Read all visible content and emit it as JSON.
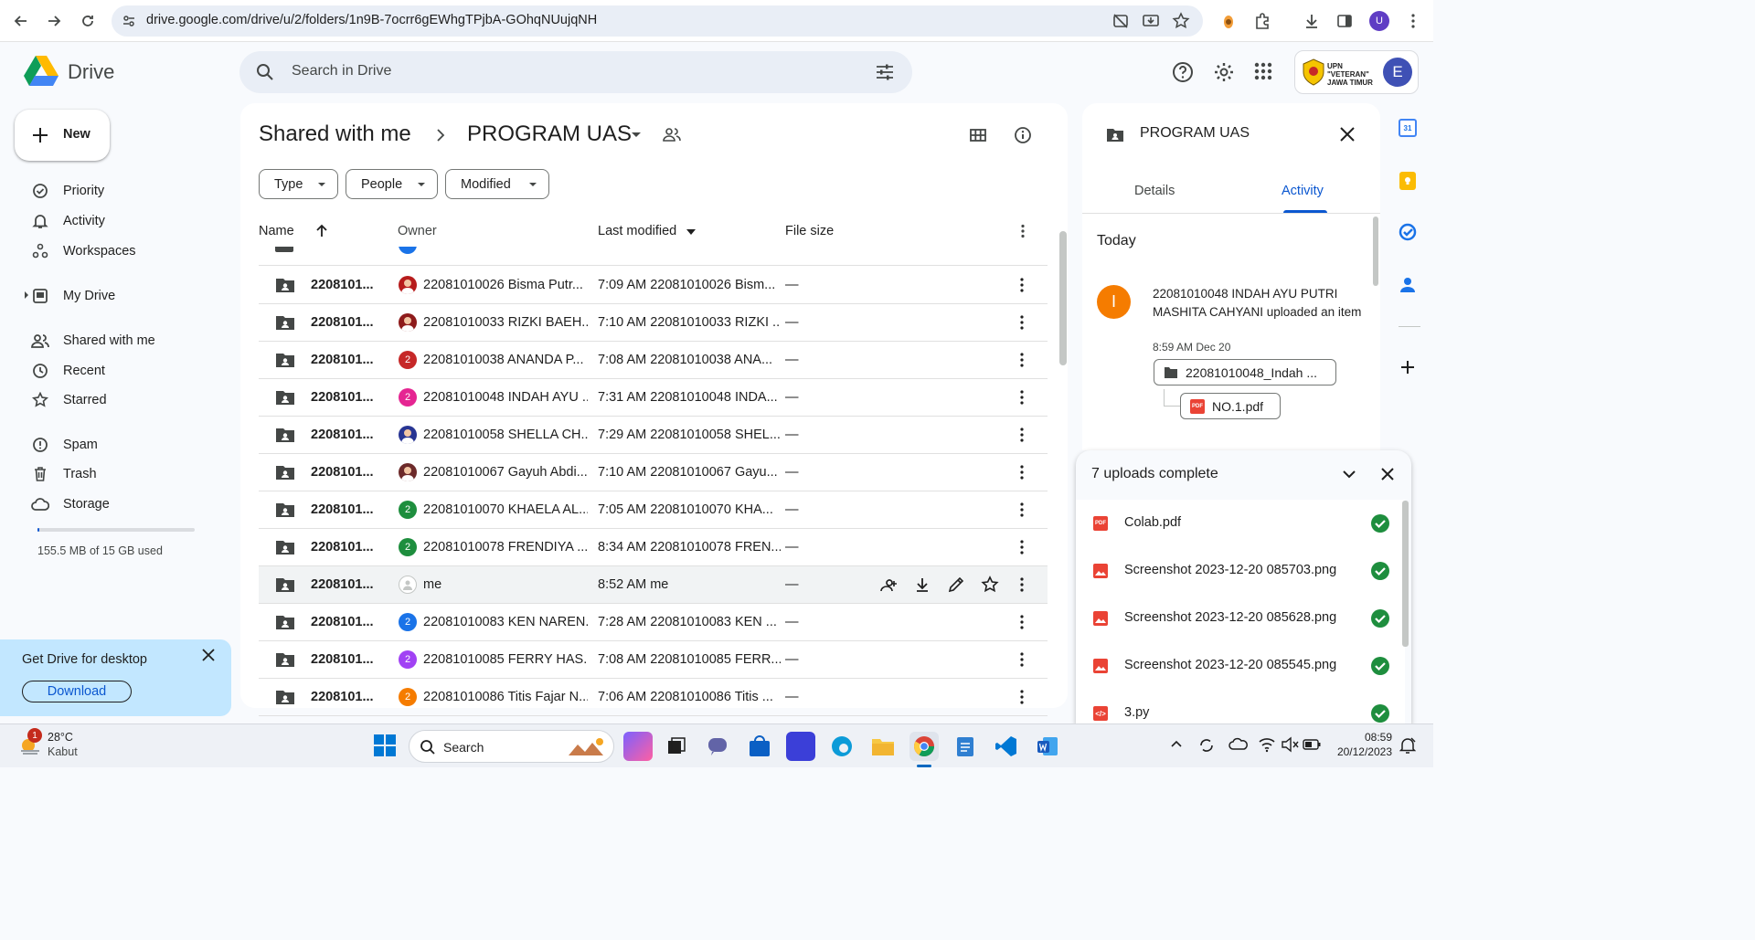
{
  "browser": {
    "url": "drive.google.com/drive/u/2/folders/1n9B-7ocrr6gEWhgTPjbA-GOhqNUujqNH",
    "profile_initial": "U"
  },
  "header": {
    "app_name": "Drive",
    "search_placeholder": "Search in Drive",
    "org_logo_text": "UPN \"VETERAN\" JAWA TIMUR",
    "account_initial": "E"
  },
  "sidebar": {
    "new_label": "New",
    "items": [
      {
        "label": "Priority",
        "icon": "checkbox-icon"
      },
      {
        "label": "Activity",
        "icon": "bell-icon"
      },
      {
        "label": "Workspaces",
        "icon": "workspaces-icon"
      },
      {
        "label": "My Drive",
        "icon": "my-drive-icon"
      },
      {
        "label": "Shared with me",
        "icon": "people-icon"
      },
      {
        "label": "Recent",
        "icon": "clock-icon"
      },
      {
        "label": "Starred",
        "icon": "star-icon"
      },
      {
        "label": "Spam",
        "icon": "spam-icon"
      },
      {
        "label": "Trash",
        "icon": "trash-icon"
      },
      {
        "label": "Storage",
        "icon": "cloud-icon"
      }
    ],
    "storage_text": "155.5 MB of 15 GB used",
    "storage_fraction": 0.01,
    "promo_title": "Get Drive for desktop",
    "promo_button": "Download"
  },
  "main": {
    "breadcrumb_parent": "Shared with me",
    "breadcrumb_current": "PROGRAM UAS",
    "filters": [
      "Type",
      "People",
      "Modified"
    ],
    "columns": {
      "name": "Name",
      "owner": "Owner",
      "modified": "Last modified",
      "size": "File size"
    },
    "rows": [
      {
        "name": "2208101...",
        "owner": "22081010026 Bisma Putr...",
        "avatar": "photo",
        "avatar_color": "#b71c1c",
        "avatar_text": "",
        "modified": "7:09 AM  22081010026 Bism...",
        "size": "—"
      },
      {
        "name": "2208101...",
        "owner": "22081010033 RIZKI BAEH...",
        "avatar": "photo",
        "avatar_color": "#8e1b1b",
        "avatar_text": "",
        "modified": "7:10 AM  22081010033 RIZKI ...",
        "size": "—"
      },
      {
        "name": "2208101...",
        "owner": "22081010038 ANANDA P...",
        "avatar": "initial",
        "avatar_color": "#c62828",
        "avatar_text": "2",
        "modified": "7:08 AM  22081010038 ANA...",
        "size": "—"
      },
      {
        "name": "2208101...",
        "owner": "22081010048 INDAH AYU ...",
        "avatar": "initial",
        "avatar_color": "#e52592",
        "avatar_text": "2",
        "modified": "7:31 AM  22081010048 INDA...",
        "size": "—"
      },
      {
        "name": "2208101...",
        "owner": "22081010058 SHELLA CH...",
        "avatar": "photo",
        "avatar_color": "#283593",
        "avatar_text": "",
        "modified": "7:29 AM  22081010058 SHEL...",
        "size": "—"
      },
      {
        "name": "2208101...",
        "owner": "22081010067 Gayuh Abdi...",
        "avatar": "photo",
        "avatar_color": "#6d2a2a",
        "avatar_text": "",
        "modified": "7:10 AM  22081010067 Gayu...",
        "size": "—"
      },
      {
        "name": "2208101...",
        "owner": "22081010070 KHAELA AL...",
        "avatar": "initial",
        "avatar_color": "#1e8e3e",
        "avatar_text": "2",
        "modified": "7:05 AM  22081010070 KHA...",
        "size": "—"
      },
      {
        "name": "2208101...",
        "owner": "22081010078 FRENDIYA ...",
        "avatar": "initial",
        "avatar_color": "#1e8e3e",
        "avatar_text": "2",
        "modified": "8:34 AM  22081010078 FREN...",
        "size": "—"
      },
      {
        "name": "2208101...",
        "owner": "me",
        "avatar": "me",
        "avatar_color": "#dadce0",
        "avatar_text": "",
        "modified": "8:52 AM  me",
        "size": "—",
        "hovered": true
      },
      {
        "name": "2208101...",
        "owner": "22081010083 KEN NAREN...",
        "avatar": "initial",
        "avatar_color": "#1a73e8",
        "avatar_text": "2",
        "modified": "7:28 AM  22081010083 KEN ...",
        "size": "—"
      },
      {
        "name": "2208101...",
        "owner": "22081010085 FERRY HAS...",
        "avatar": "initial",
        "avatar_color": "#a142f4",
        "avatar_text": "2",
        "modified": "7:08 AM  22081010085 FERR...",
        "size": "—"
      },
      {
        "name": "2208101...",
        "owner": "22081010086 Titis Fajar N...",
        "avatar": "initial",
        "avatar_color": "#f57c00",
        "avatar_text": "2",
        "modified": "7:06 AM  22081010086 Titis ...",
        "size": "—"
      }
    ]
  },
  "details": {
    "title": "PROGRAM UAS",
    "tab_details": "Details",
    "tab_activity": "Activity",
    "day": "Today",
    "activity_avatar": "I",
    "activity_text": "22081010048 INDAH AYU PUTRI MASHITA CAHYANI uploaded an item",
    "activity_time": "8:59 AM Dec 20",
    "folder_chip": "22081010048_Indah ...",
    "file_chip": "NO.1.pdf"
  },
  "uploads": {
    "title": "7 uploads complete",
    "items": [
      {
        "name": "Colab.pdf",
        "type": "pdf"
      },
      {
        "name": "Screenshot 2023-12-20 085703.png",
        "type": "image"
      },
      {
        "name": "Screenshot 2023-12-20 085628.png",
        "type": "image"
      },
      {
        "name": "Screenshot 2023-12-20 085545.png",
        "type": "image"
      },
      {
        "name": "3.py",
        "type": "code"
      }
    ]
  },
  "taskbar": {
    "weather_temp": "28°C",
    "weather_desc": "Kabut",
    "weather_badge": "1",
    "search_label": "Search",
    "time": "08:59",
    "date": "20/12/2023"
  }
}
